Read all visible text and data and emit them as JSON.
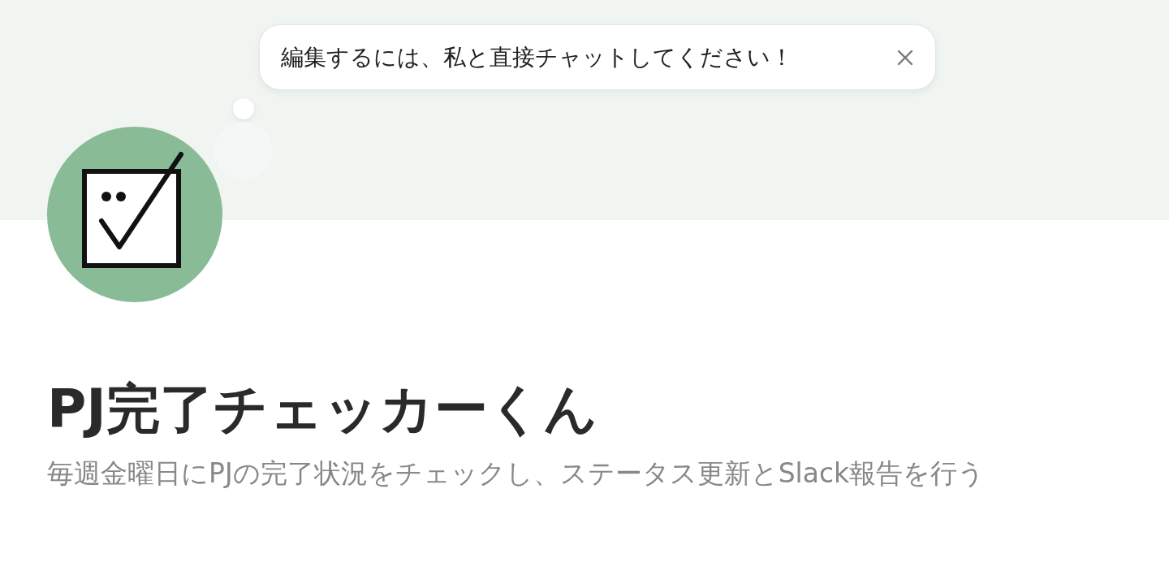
{
  "tooltip": {
    "text": "編集するには、私と直接チャットしてください！"
  },
  "agent": {
    "name": "PJ完了チェッカーくん",
    "description": "毎週金曜日にPJの完了状況をチェックし、ステータス更新とSlack報告を行う"
  }
}
